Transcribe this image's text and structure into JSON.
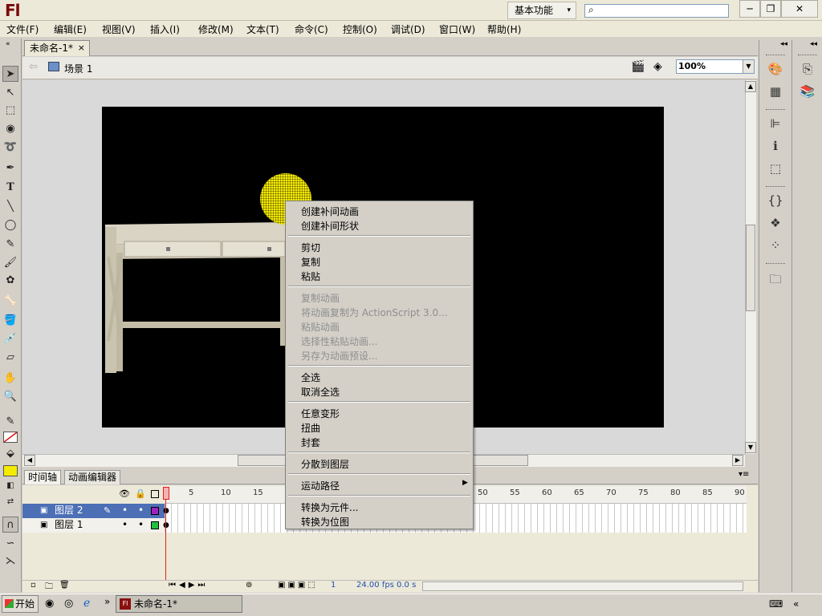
{
  "app": {
    "logo": "Fl",
    "workspace": "基本功能",
    "search_placeholder": ""
  },
  "window_buttons": [
    "─",
    "❐",
    "✕"
  ],
  "menu": [
    "文件(F)",
    "编辑(E)",
    "视图(V)",
    "插入(I)",
    "修改(M)",
    "文本(T)",
    "命令(C)",
    "控制(O)",
    "调试(D)",
    "窗口(W)",
    "帮助(H)"
  ],
  "doc_tab": {
    "title": "未命名-1*",
    "close": "×"
  },
  "scene": {
    "label": "场景 1",
    "zoom": "100%"
  },
  "timeline": {
    "tabs": [
      "时间轴",
      "动画编辑器"
    ],
    "ruler": [
      "1",
      "5",
      "10",
      "15",
      "50",
      "55",
      "60",
      "65",
      "70",
      "75",
      "80",
      "85",
      "90"
    ],
    "layers": [
      {
        "name": "图层 2",
        "color": "#a020c0",
        "selected": true
      },
      {
        "name": "图层 1",
        "color": "#20c040",
        "selected": false
      }
    ],
    "frame": "1",
    "fps": "24.00 fps",
    "time": "0.0 s"
  },
  "context_menu": {
    "groups": [
      [
        {
          "label": "创建补间动画",
          "enabled": true
        },
        {
          "label": "创建补间形状",
          "enabled": true
        }
      ],
      [
        {
          "label": "剪切",
          "enabled": true
        },
        {
          "label": "复制",
          "enabled": true
        },
        {
          "label": "粘贴",
          "enabled": true
        }
      ],
      [
        {
          "label": "复制动画",
          "enabled": false
        },
        {
          "label": "将动画复制为 ActionScript 3.0...",
          "enabled": false
        },
        {
          "label": "粘贴动画",
          "enabled": false
        },
        {
          "label": "选择性粘贴动画...",
          "enabled": false
        },
        {
          "label": "另存为动画预设...",
          "enabled": false
        }
      ],
      [
        {
          "label": "全选",
          "enabled": true
        },
        {
          "label": "取消全选",
          "enabled": true
        }
      ],
      [
        {
          "label": "任意变形",
          "enabled": true
        },
        {
          "label": "扭曲",
          "enabled": true
        },
        {
          "label": "封套",
          "enabled": true
        }
      ],
      [
        {
          "label": "分散到图层",
          "enabled": true
        }
      ],
      [
        {
          "label": "运动路径",
          "enabled": true,
          "submenu": true
        }
      ],
      [
        {
          "label": "转换为元件...",
          "enabled": true
        },
        {
          "label": "转换为位图",
          "enabled": true
        }
      ]
    ]
  },
  "taskbar": {
    "start": "开始",
    "window": "未命名-1*",
    "chevron": "»"
  },
  "colors": {
    "stage": "#000000",
    "fill": "#f4eb00"
  }
}
